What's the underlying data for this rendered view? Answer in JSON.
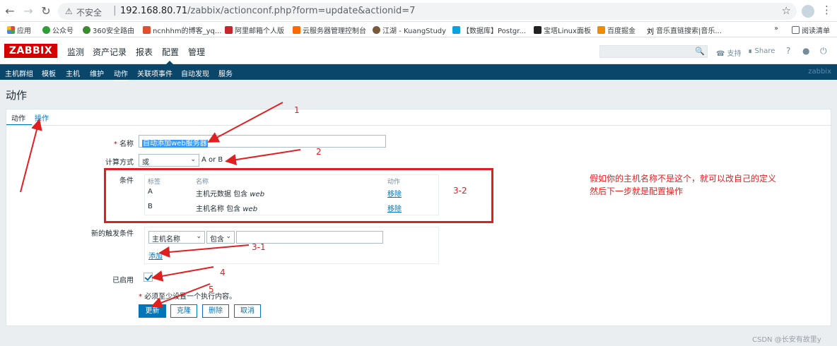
{
  "browser": {
    "insecure_label": "不安全",
    "url_host": "192.168.80.71",
    "url_path": "/zabbix/actionconf.php?form=update&actionid=7",
    "bookmarks": [
      "应用",
      "公众号",
      "360安全路由",
      "ncnhhm的博客_yq...",
      "阿里邮箱个人版",
      "云服务器管理控制台",
      "江湖 - KuangStudy",
      "【数据库】Postgr...",
      "宝塔Linux面板",
      "百度掘金",
      "音乐直链搜索|音乐...",
      "阅读清单"
    ],
    "bookmark_overflow": "»"
  },
  "zabbix": {
    "logo": "ZABBIX",
    "main_nav": [
      "监测",
      "资产记录",
      "报表",
      "配置",
      "管理"
    ],
    "support": "支持",
    "share": "Share",
    "help": "?",
    "sub_nav": [
      "主机群组",
      "模板",
      "主机",
      "维护",
      "动作",
      "关联项事件",
      "自动发现",
      "服务"
    ],
    "sub_nav_right": "zabbix",
    "page_title": "动作"
  },
  "form": {
    "tabs": [
      "动作",
      "操作"
    ],
    "name_label": "名称",
    "name_value": "自动添加web服务器",
    "calc_label": "计算方式",
    "calc_value": "或",
    "calc_formula": "A or B",
    "conditions_label": "条件",
    "cond_headers": [
      "标签",
      "名称",
      "动作"
    ],
    "conditions": [
      {
        "label": "A",
        "name_prefix": "主机元数据 包含 ",
        "name_value": "web",
        "action": "移除"
      },
      {
        "label": "B",
        "name_prefix": "主机名称 包含 ",
        "name_value": "web",
        "action": "移除"
      }
    ],
    "new_cond_label": "新的触发条件",
    "new_cond_type": "主机名称",
    "new_cond_op": "包含",
    "new_cond_value": "",
    "add_link": "添加",
    "enabled_label": "已启用",
    "note": "必须至少设置一个执行内容。",
    "buttons": [
      "更新",
      "克隆",
      "删除",
      "取消"
    ]
  },
  "annotations": {
    "n1": "1",
    "n2": "2",
    "n3_2": "3-2",
    "n3_1": "3-1",
    "n4": "4",
    "n5": "5",
    "note_line1": "假如你的主机名称不是这个，就可以改自己的定义",
    "note_line2": "然后下一步就是配置操作",
    "watermark": "CSDN @长安有故里y"
  },
  "colors": {
    "accent": "#0275b8",
    "brand": "#d40000",
    "subnav": "#0a466a",
    "annotation": "#e02020"
  }
}
